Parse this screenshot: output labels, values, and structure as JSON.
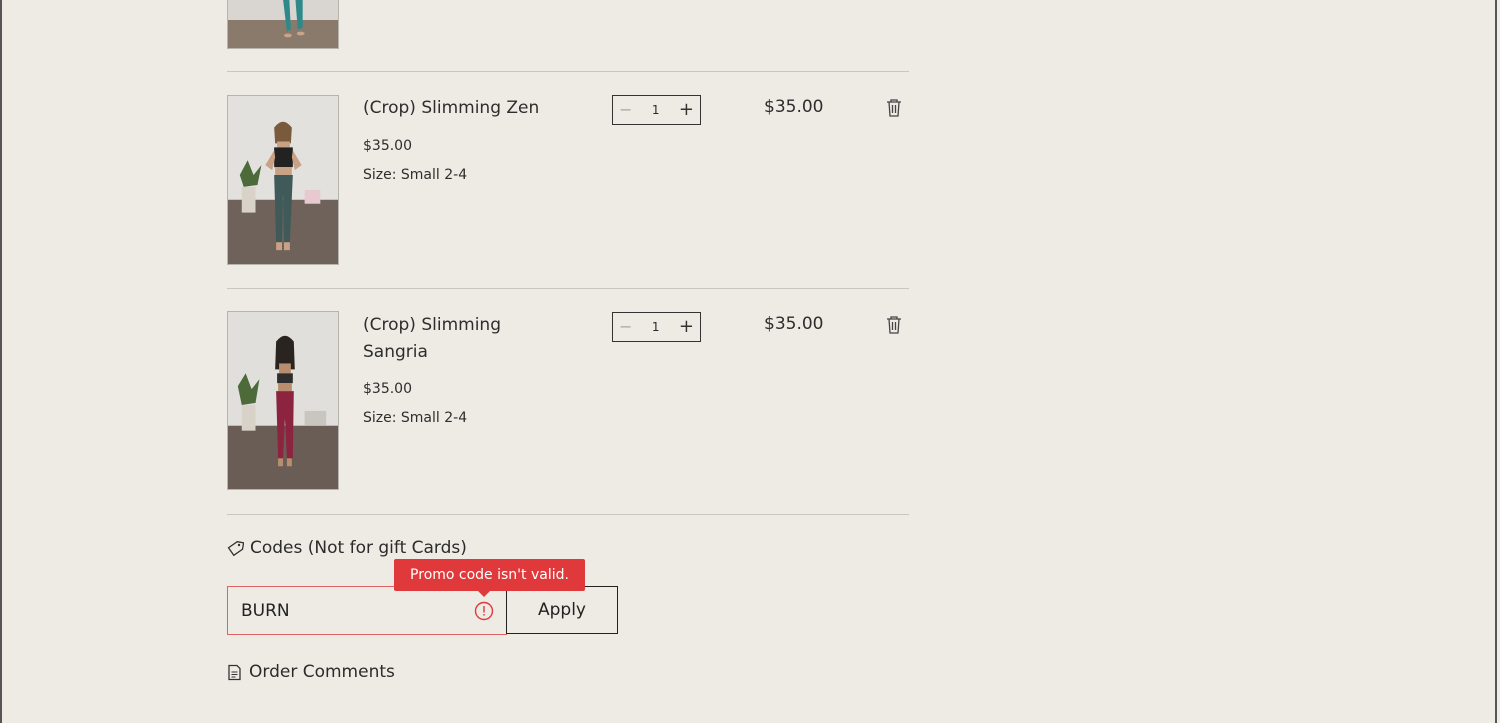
{
  "cart": {
    "items": [
      {
        "name": "(Crop) Slimming Zen",
        "price": "$35.00",
        "size": "Size: Small 2-4",
        "quantity": "1",
        "total": "$35.00",
        "legging_color": "#3f5a58"
      },
      {
        "name": "(Crop) Slimming Sangria",
        "price": "$35.00",
        "size": "Size: Small 2-4",
        "quantity": "1",
        "total": "$35.00",
        "legging_color": "#8c2440"
      }
    ],
    "codes": {
      "label": "Codes (Not for gift Cards)",
      "value": "BURN",
      "error": "Promo code isn't valid.",
      "apply_label": "Apply"
    },
    "order_comments_label": "Order Comments"
  },
  "colors": {
    "background": "#eeebe5",
    "error": "#e0393c",
    "text": "#2d2d2d"
  }
}
